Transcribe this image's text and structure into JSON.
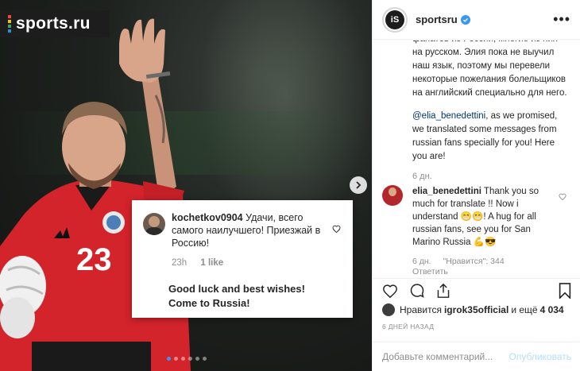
{
  "photo": {
    "logo_text": "sports.ru",
    "card": {
      "username": "kochetkov0904",
      "comment": "Удачи, всего самого наилучшего! Приезжай в Россию!",
      "time": "23h",
      "likes": "1 like",
      "translation_line1": "Good luck and best wishes!",
      "translation_line2": "Come to Russia!"
    }
  },
  "header": {
    "avatar_text": "iS",
    "username": "sportsru",
    "more_icon": "more-horizontal-icon"
  },
  "caption": {
    "partial_top": "фанатов из России, многие из них – на русском. Элия пока не выучил наш язык, поэтому мы перевели некоторые пожелания болельщиков на английский специально для него.",
    "mention": "@elia_benedettini",
    "english": ", as we promised, we translated some messages from russian fans specially for you! Here you are!",
    "time": "6 дн."
  },
  "reply": {
    "username": "elia_benedettini",
    "text": "Thank you so much for translate !! Now i understand 😁😁! A hug for all russian fans, see you for San Marino Russia 💪😎",
    "time": "6 дн.",
    "likes": "\"Нравится\": 344",
    "reply_label": "Ответить"
  },
  "likes": {
    "prefix": "Нравится",
    "user": "igrok35official",
    "middle": "и ещё",
    "count": "4 034"
  },
  "date": "6 ДНЕЙ НАЗАД",
  "comment_input": {
    "placeholder": "Добавьте комментарий...",
    "publish": "Опубликовать"
  },
  "colors": {
    "accent": "#3897f0",
    "link": "#003569",
    "muted": "#8e8e8e",
    "jersey": "#d3232b"
  }
}
